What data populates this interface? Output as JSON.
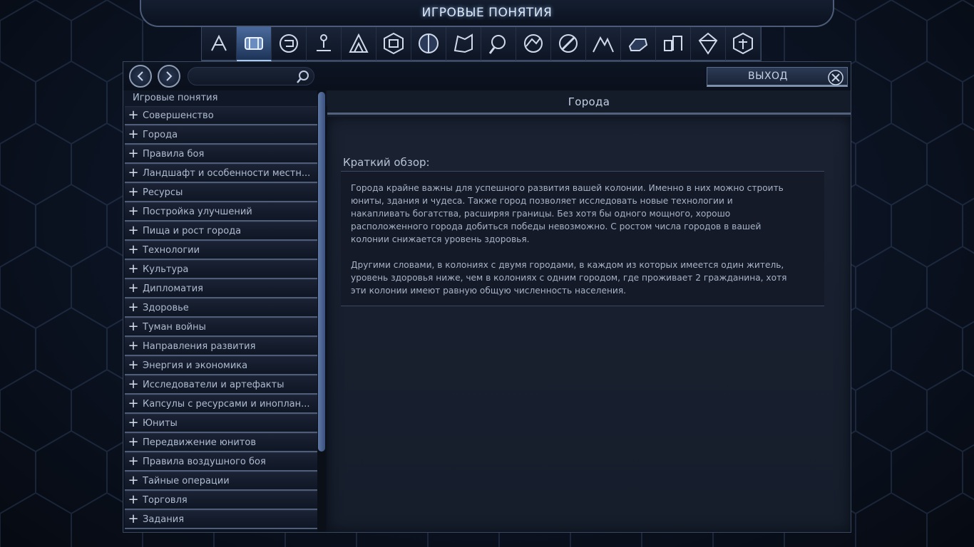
{
  "window": {
    "title": "ИГРОВЫЕ ПОНЯТИЯ"
  },
  "categories": [
    {
      "icon": "compass-icon",
      "active": false
    },
    {
      "icon": "game-concepts-icon",
      "active": true
    },
    {
      "icon": "tech-web-icon",
      "active": false
    },
    {
      "icon": "unit-figure-icon",
      "active": false
    },
    {
      "icon": "affinity-icon",
      "active": false
    },
    {
      "icon": "buildings-icon",
      "active": false
    },
    {
      "icon": "wonders-icon",
      "active": false
    },
    {
      "icon": "terrain-icon",
      "active": false
    },
    {
      "icon": "explore-icon",
      "active": false
    },
    {
      "icon": "map-icon",
      "active": false
    },
    {
      "icon": "orbital-icon",
      "active": false
    },
    {
      "icon": "alien-icon",
      "active": false
    },
    {
      "icon": "resource-icon",
      "active": false
    },
    {
      "icon": "improvements-icon",
      "active": false
    },
    {
      "icon": "stations-icon",
      "active": false
    },
    {
      "icon": "faction-icon",
      "active": false
    }
  ],
  "nav": {
    "search_placeholder": "",
    "exit_label": "ВЫХОД"
  },
  "sidebar": {
    "header": "Игровые понятия",
    "items": [
      "Совершенство",
      "Города",
      "Правила боя",
      "Ландшафт и особенности местн...",
      "Ресурсы",
      "Постройка улучшений",
      "Пища и рост города",
      "Технологии",
      "Культура",
      "Дипломатия",
      "Здоровье",
      "Туман войны",
      "Направления развития",
      "Энергия и экономика",
      "Исследователи и артефакты",
      "Капсулы с ресурсами и иноплан...",
      "Юниты",
      "Передвижение юнитов",
      "Правила воздушного боя",
      "Тайные операции",
      "Торговля",
      "Задания"
    ]
  },
  "content": {
    "title": "Города",
    "summary_title": "Краткий обзор:",
    "paragraph1": "Города крайне важны для успешного развития вашей колонии. Именно в них можно строить юниты, здания и чудеса. Также город позволяет исследовать новые технологии и накапливать богатства, расширяя границы. Без хотя бы одного мощного, хорошо расположенного города добиться победы невозможно. С ростом числа городов в вашей колонии снижается уровень здоровья.",
    "paragraph2": "Другими словами, в колониях с двумя городами, в каждом из которых имеется один житель, уровень здоровья ниже, чем в колониях с одним городом, где проживает 2 гражданина, хотя эти колонии имеют равную общую численность населения."
  },
  "colors": {
    "accent": "#a8c8f0",
    "panel": "#0f1726",
    "text": "#aebbd0"
  }
}
